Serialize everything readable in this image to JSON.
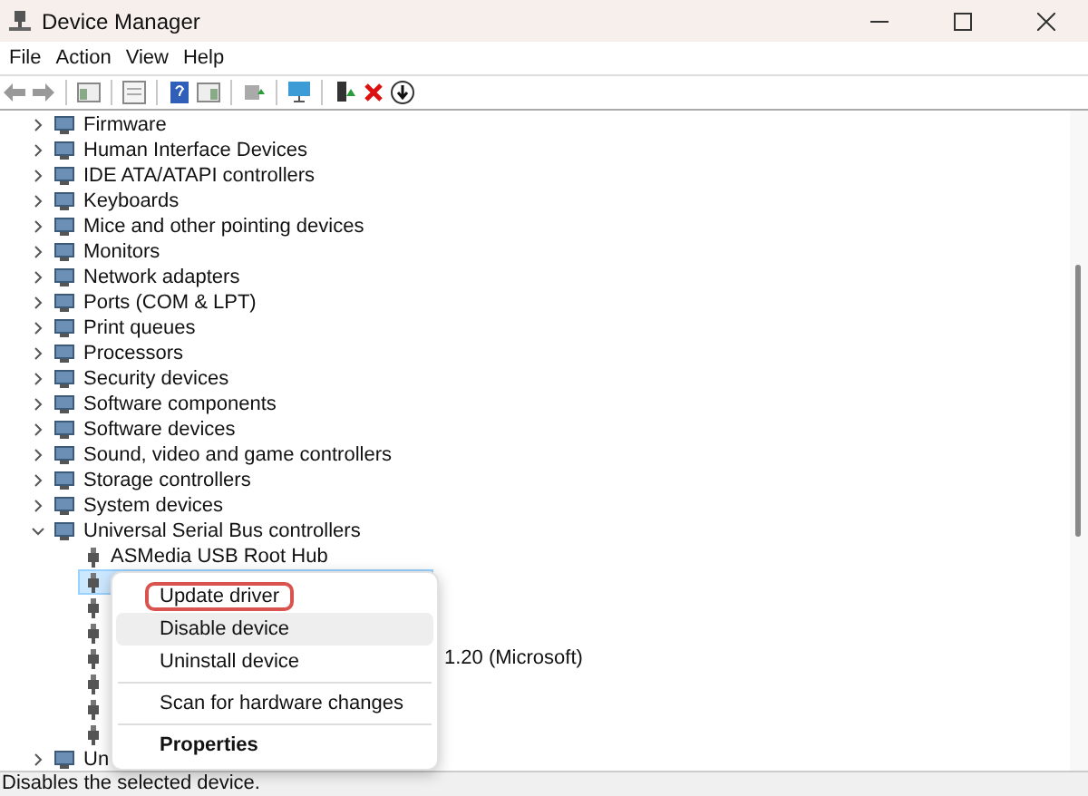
{
  "window": {
    "title": "Device Manager"
  },
  "menu": [
    "File",
    "Action",
    "View",
    "Help"
  ],
  "tree": [
    {
      "label": "Firmware",
      "expanded": false
    },
    {
      "label": "Human Interface Devices",
      "expanded": false
    },
    {
      "label": "IDE ATA/ATAPI controllers",
      "expanded": false
    },
    {
      "label": "Keyboards",
      "expanded": false
    },
    {
      "label": "Mice and other pointing devices",
      "expanded": false
    },
    {
      "label": "Monitors",
      "expanded": false
    },
    {
      "label": "Network adapters",
      "expanded": false
    },
    {
      "label": "Ports (COM & LPT)",
      "expanded": false
    },
    {
      "label": "Print queues",
      "expanded": false
    },
    {
      "label": "Processors",
      "expanded": false
    },
    {
      "label": "Security devices",
      "expanded": false
    },
    {
      "label": "Software components",
      "expanded": false
    },
    {
      "label": "Software devices",
      "expanded": false
    },
    {
      "label": "Sound, video and game controllers",
      "expanded": false
    },
    {
      "label": "Storage controllers",
      "expanded": false
    },
    {
      "label": "System devices",
      "expanded": false
    },
    {
      "label": "Universal Serial Bus controllers",
      "expanded": true,
      "children": [
        {
          "label": "ASMedia USB Root Hub",
          "selected": false,
          "kind": "full"
        },
        {
          "selected": true,
          "kind": "hidden"
        },
        {
          "selected": false,
          "kind": "hidden"
        },
        {
          "selected": false,
          "kind": "hidden"
        },
        {
          "label": "1.20 (Microsoft)",
          "selected": false,
          "kind": "tail"
        },
        {
          "selected": false,
          "kind": "hidden"
        },
        {
          "selected": false,
          "kind": "hidden"
        },
        {
          "selected": false,
          "kind": "hidden"
        }
      ]
    },
    {
      "label": "Un",
      "expanded": false
    }
  ],
  "context_menu": [
    {
      "kind": "command",
      "label": "Update driver",
      "hovered": false,
      "highlighted": true,
      "default": false
    },
    {
      "kind": "command",
      "label": "Disable device",
      "hovered": true,
      "highlighted": false,
      "default": false
    },
    {
      "kind": "command",
      "label": "Uninstall device",
      "hovered": false,
      "highlighted": false,
      "default": false
    },
    {
      "kind": "separator"
    },
    {
      "kind": "command",
      "label": "Scan for hardware changes",
      "hovered": false,
      "highlighted": false,
      "default": false
    },
    {
      "kind": "separator"
    },
    {
      "kind": "command",
      "label": "Properties",
      "hovered": false,
      "highlighted": false,
      "default": true
    }
  ],
  "status_bar": "Disables the selected device."
}
